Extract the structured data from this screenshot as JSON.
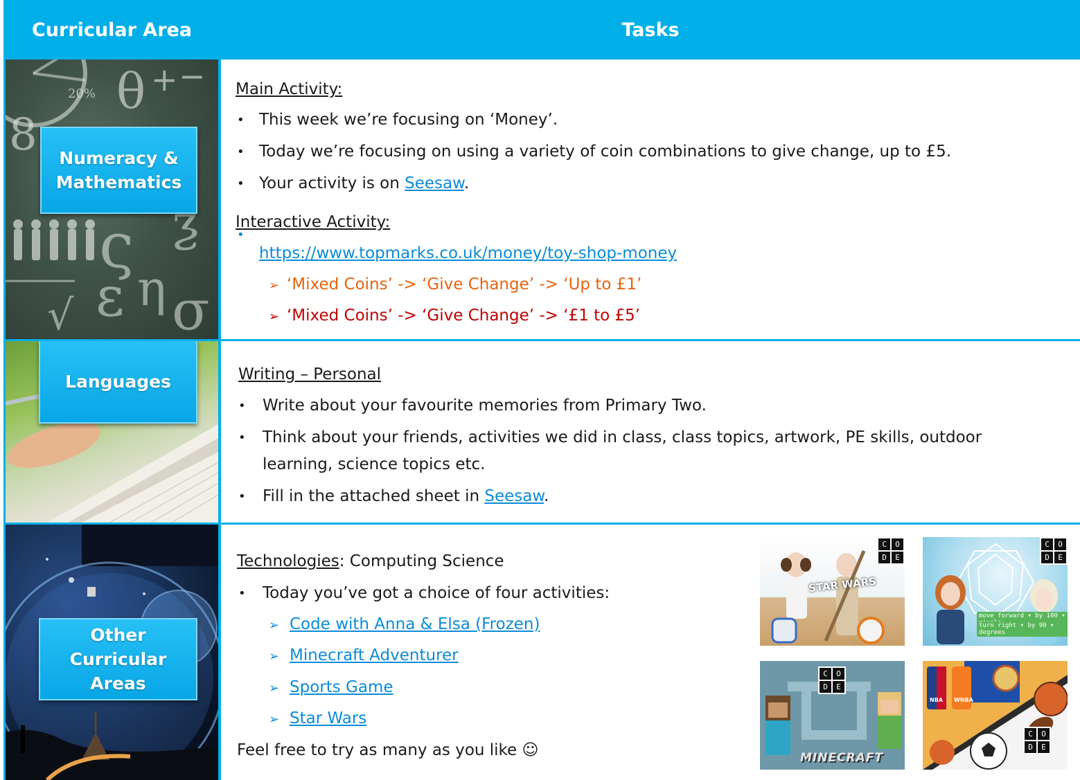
{
  "header": {
    "curricular_area": "Curricular Area",
    "tasks": "Tasks"
  },
  "numeracy": {
    "area_label_line1": "Numeracy &",
    "area_label_line2": "Mathematics",
    "main_heading": "Main Activity:",
    "bullets": [
      "This week we’re focusing on ‘Money’.",
      "Today we’re focusing on using a variety of coin combinations to give change, up to £5."
    ],
    "seesaw_prefix": "Your activity is on ",
    "seesaw_link": "Seesaw",
    "seesaw_suffix": ".",
    "interactive_heading": "Interactive Activity:",
    "topmarks_link": "https://www.topmarks.co.uk/money/toy-shop-money",
    "sub_items": [
      {
        "text": "‘Mixed Coins’ -> ‘Give Change’ -> ‘Up to £1’",
        "color": "#e8620e"
      },
      {
        "text": "‘Mixed Coins’ -> ‘Give Change’ -> ‘£1 to £5’",
        "color": "#c00000"
      }
    ]
  },
  "languages": {
    "area_label": "Languages",
    "heading": "Writing – Personal",
    "bullet1": "Write about your favourite memories from Primary Two.",
    "bullet2_line1": "Think about your friends, activities we did in class, class topics, artwork, PE skills, outdoor",
    "bullet2_line2": "learning, science topics etc.",
    "bullet3_prefix": "Fill in the attached sheet in ",
    "bullet3_link": "Seesaw",
    "bullet3_suffix": "."
  },
  "other": {
    "area_label_line1": "Other",
    "area_label_line2": "Curricular",
    "area_label_line3": "Areas",
    "heading_underlined": "Technologies",
    "heading_rest": ": Computing Science",
    "bullet": "Today you’ve got a choice of four activities:",
    "links": [
      "Code with Anna & Elsa (Frozen)",
      "Minecraft Adventurer",
      "Sports Game",
      "Star Wars"
    ],
    "footer": "Feel free to try as many as you like ☺"
  },
  "thumbnails": {
    "starwars_logo": "STAR WARS",
    "minecraft_logo": "MINECRAFT",
    "frozen_block1": "move forward ▾ by 100 ▾ pixels",
    "frozen_block2": "turn right ▾ by 90 ▾ degrees",
    "code_letters": [
      "C",
      "O",
      "D",
      "E"
    ],
    "nba_label": "NBA",
    "wnba_label": "WNBA"
  },
  "colors": {
    "accent": "#00aee8",
    "link": "#0b8bd7",
    "orange": "#e8620e",
    "red": "#c00000"
  }
}
